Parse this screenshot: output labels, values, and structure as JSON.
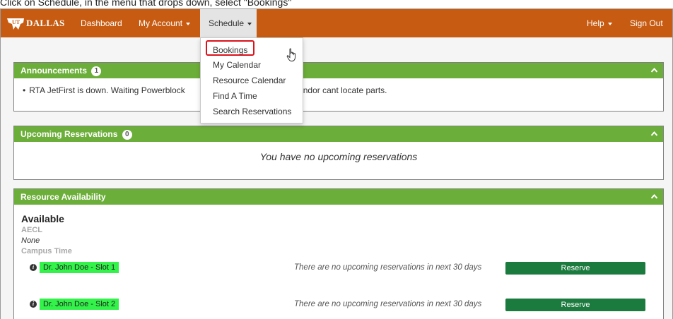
{
  "instruction": "Click on Schedule, in the menu that drops down, select \"Bookings\"",
  "brand": {
    "text": "DALLAS"
  },
  "nav": {
    "dashboard": "Dashboard",
    "my_account": "My Account",
    "schedule": "Schedule",
    "help": "Help",
    "sign_out": "Sign Out"
  },
  "schedule_menu": [
    "Bookings",
    "My Calendar",
    "Resource Calendar",
    "Find A Time",
    "Search Reservations"
  ],
  "announcements": {
    "title": "Announcements",
    "count": "1",
    "text_start": "RTA JetFirst is down. Waiting Powerblock",
    "text_end": "Vendor cant locate parts."
  },
  "upcoming": {
    "title": "Upcoming Reservations",
    "count": "0",
    "empty_text": "You have no upcoming reservations"
  },
  "availability": {
    "title": "Resource Availability",
    "section": "Available",
    "group": "AECL",
    "group_value": "None",
    "subgroup": "Campus Time",
    "slots": [
      {
        "label": "Dr. John Doe - Slot 1",
        "message": "There are no upcoming reservations in next 30 days",
        "button": "Reserve"
      },
      {
        "label": "Dr. John Doe - Slot 2",
        "message": "There are no upcoming reservations in next 30 days",
        "button": "Reserve"
      }
    ]
  },
  "colors": {
    "navbar": "#c75b12",
    "panel_header": "#6cae3a",
    "slot_highlight": "#33f24a",
    "reserve_button": "#1b7a3e",
    "menu_highlight_border": "#d9131c"
  }
}
